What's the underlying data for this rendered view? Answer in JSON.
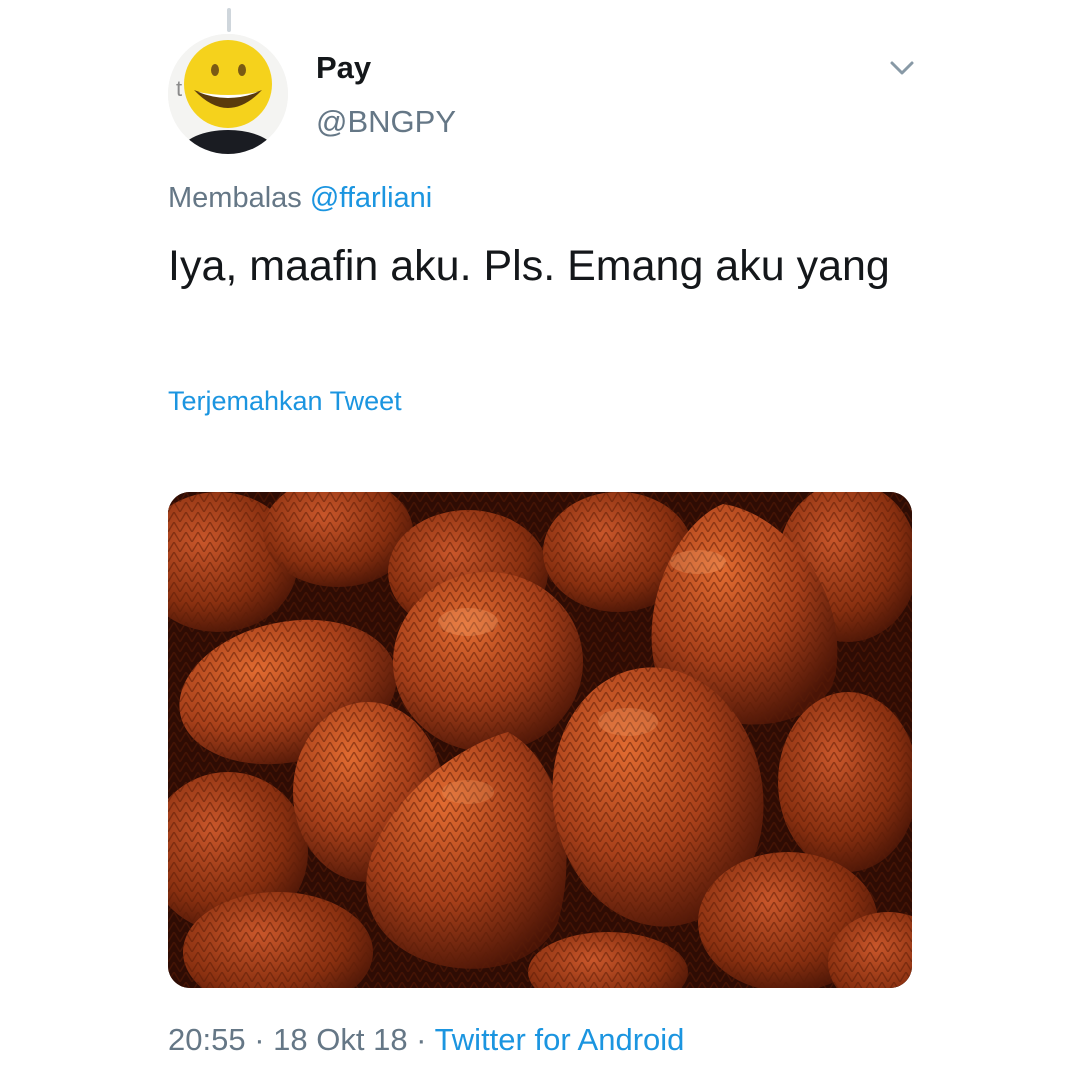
{
  "tweet": {
    "display_name": "Pay",
    "handle": "@BNGPY",
    "reply_prefix": "Membalas",
    "reply_to": "@ffarliani",
    "text": "Iya, maafin aku. Pls. Emang aku yang",
    "translate_label": "Terjemahkan Tweet",
    "time": "20:55",
    "date": "18 Okt 18",
    "source": "Twitter for Android",
    "separator": " · "
  },
  "media": {
    "subject": "salak (snake fruit) photo"
  },
  "icons": {
    "menu": "chevron-down-icon"
  },
  "colors": {
    "text": "#14171a",
    "secondary": "#657786",
    "link": "#1b95e0",
    "fruit": "#a8401a"
  }
}
